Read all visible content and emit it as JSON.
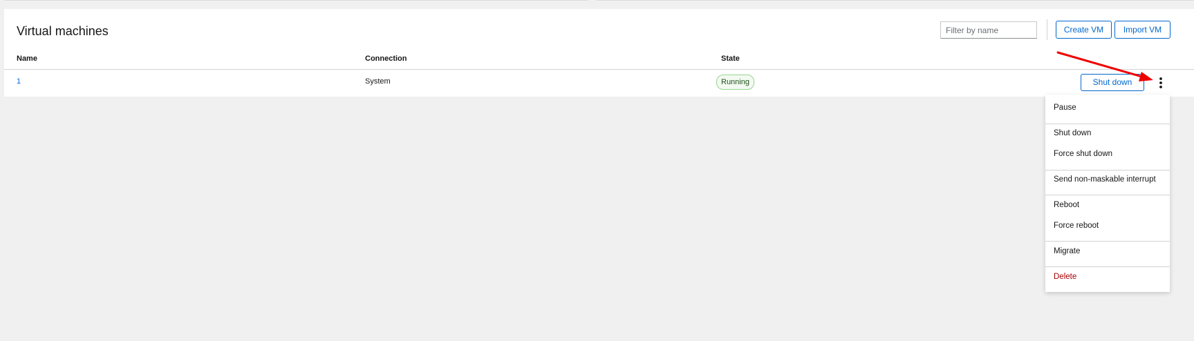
{
  "card": {
    "title": "Virtual machines",
    "filter_placeholder": "Filter by name",
    "filter_value": "",
    "create_label": "Create VM",
    "import_label": "Import VM"
  },
  "table": {
    "headers": [
      "Name",
      "Connection",
      "State"
    ],
    "rows": [
      {
        "name": "1",
        "connection": "System",
        "state": "Running",
        "action_label": "Shut down"
      }
    ]
  },
  "menu": {
    "items": [
      {
        "label": "Pause"
      },
      {
        "label": "Shut down"
      },
      {
        "label": "Force shut down"
      },
      {
        "label": "Send non-maskable interrupt"
      },
      {
        "label": "Reboot"
      },
      {
        "label": "Force reboot"
      },
      {
        "label": "Migrate"
      },
      {
        "label": "Delete",
        "danger": true
      }
    ]
  },
  "icons": {
    "kebab": "kebab-menu-icon",
    "arrow": "red-annotation-arrow"
  },
  "colors": {
    "link": "#0066cc",
    "background": "#f0f0f0",
    "running_badge_border": "#95d58e",
    "danger_text": "#a30000",
    "annotation": "#ee0000"
  }
}
